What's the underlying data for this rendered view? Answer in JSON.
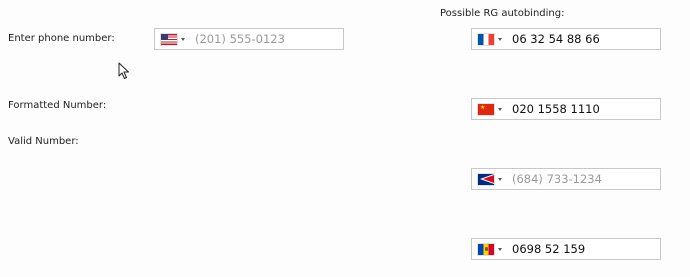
{
  "labels": {
    "enter_phone": "Enter phone number:",
    "formatted": "Formatted Number:",
    "valid": "Valid Number:",
    "possible_rg": "Possible RG autobinding:"
  },
  "main_input": {
    "country": "us",
    "flag_icon": "us-flag-icon",
    "value": "",
    "placeholder": "(201) 555-0123"
  },
  "rg_inputs": [
    {
      "country": "fr",
      "flag_icon": "france-flag-icon",
      "value": "06 32 54 88 66",
      "placeholder": ""
    },
    {
      "country": "cn",
      "flag_icon": "china-flag-icon",
      "value": "020 1558 1110",
      "placeholder": ""
    },
    {
      "country": "as",
      "flag_icon": "american-samoa-flag-icon",
      "value": "",
      "placeholder": "(684) 733-1234"
    },
    {
      "country": "md",
      "flag_icon": "moldova-flag-icon",
      "value": "0698 52 159",
      "placeholder": ""
    }
  ],
  "colors": {
    "border": "#c8c8c8",
    "placeholder": "#9a9a9a",
    "text": "#111111"
  }
}
